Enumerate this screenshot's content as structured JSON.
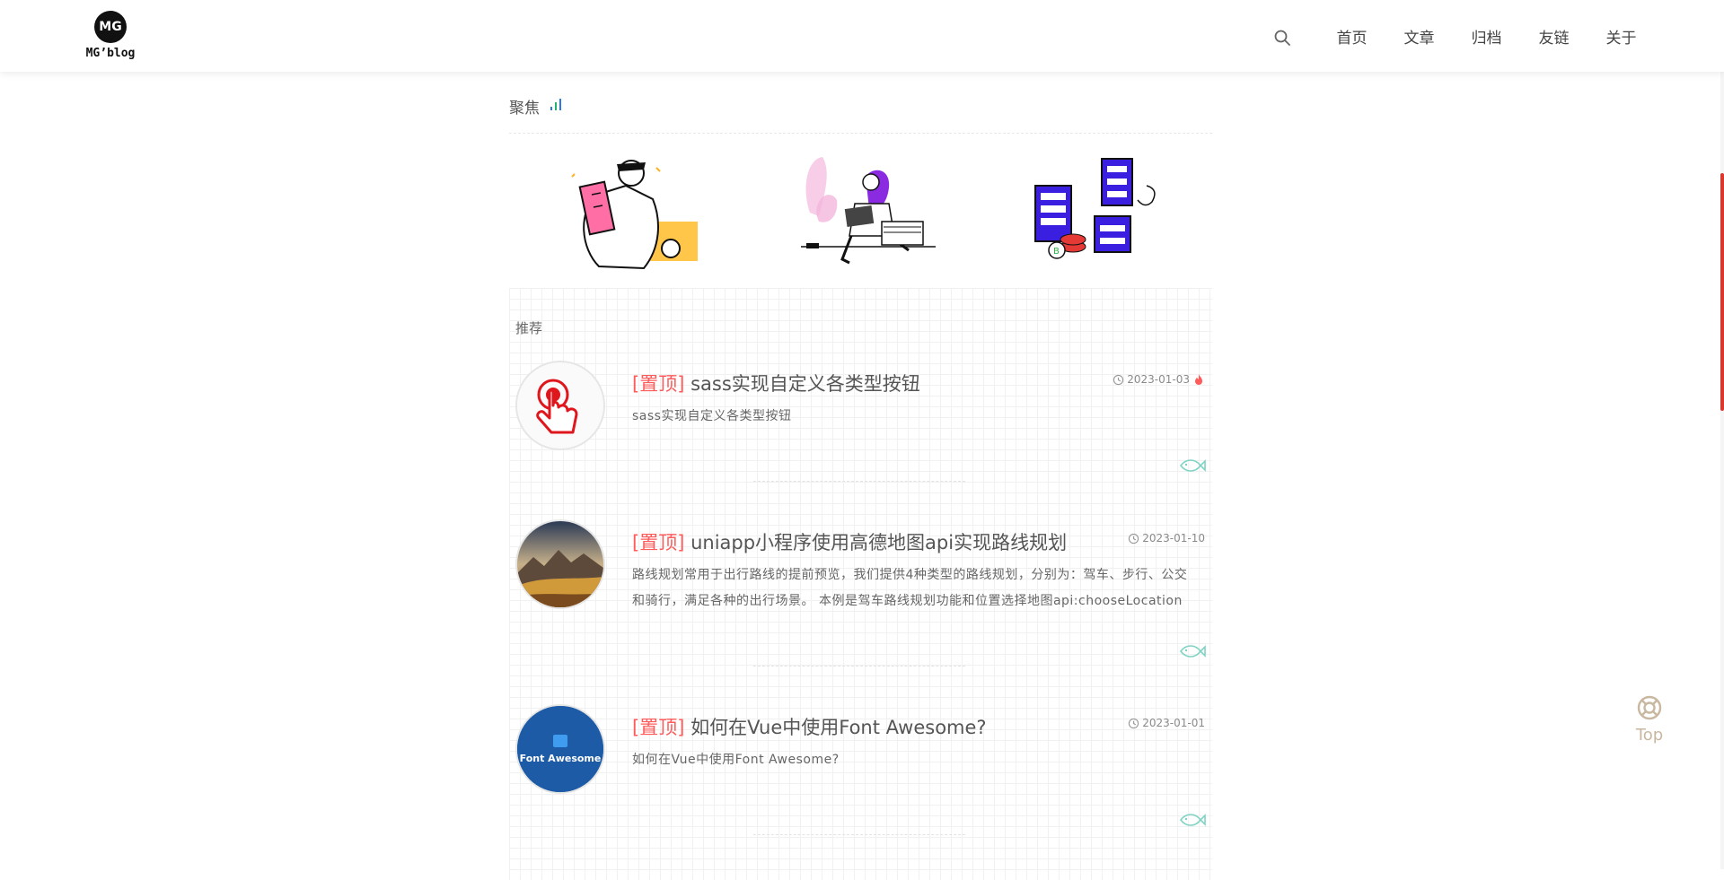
{
  "header": {
    "logo_mark": "MG",
    "logo_text": "MG’blog",
    "nav": [
      "首页",
      "文章",
      "归档",
      "友链",
      "关于"
    ]
  },
  "focus": {
    "title": "聚焦",
    "illustrations": [
      "reading-person-illustration",
      "woman-with-laptop-illustration",
      "servers-illustration"
    ]
  },
  "recommend": {
    "title": "推荐",
    "pin_label": "[置顶]",
    "posts": [
      {
        "title": "sass实现自定义各类型按钮",
        "date": "2023-01-03",
        "excerpt": "sass实现自定义各类型按钮",
        "hot": true,
        "thumb": "pointer-hand-icon"
      },
      {
        "title": "uniapp小程序使用高德地图api实现路线规划",
        "date": "2023-01-10",
        "excerpt": "路线规划常用于出行路线的提前预览，我们提供4种类型的路线规划，分别为：驾车、步行、公交和骑行，满足各种的出行场景。 本例是驾车路线规划功能和位置选择地图api:chooseLocation",
        "hot": false,
        "thumb": "landscape-photo"
      },
      {
        "title": "如何在Vue中使用Font Awesome?",
        "date": "2023-01-01",
        "excerpt": "如何在Vue中使用Font Awesome?",
        "hot": false,
        "thumb": "font-awesome-logo",
        "thumb_text": "Font Awesome"
      }
    ]
  },
  "back_to_top": {
    "label": "Top"
  },
  "colors": {
    "pin": "#ff5b5b",
    "scroll_accent": "#d9382e",
    "fish": "#7fd3c4"
  }
}
